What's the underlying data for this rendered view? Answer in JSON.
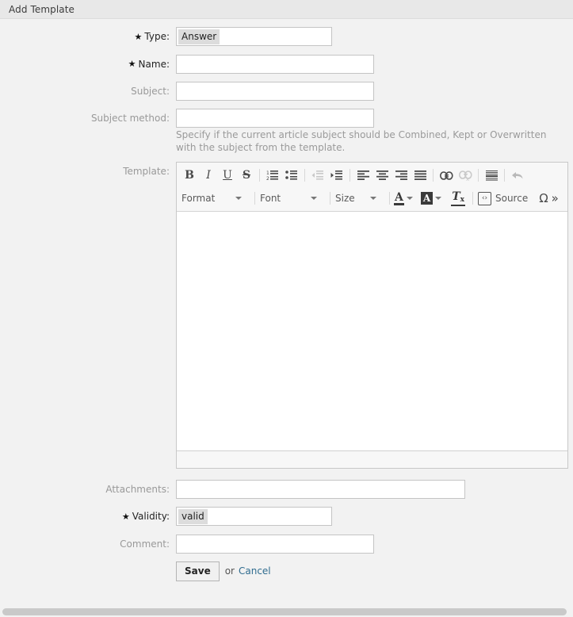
{
  "window": {
    "title": "Add Template"
  },
  "form": {
    "fields": [
      {
        "key": "type",
        "label": "Type:",
        "required": true,
        "control": "listbox",
        "value": "Answer"
      },
      {
        "key": "name",
        "label": "Name:",
        "required": true,
        "control": "text",
        "value": "",
        "placeholder": ""
      },
      {
        "key": "subject",
        "label": "Subject:",
        "required": false,
        "control": "text",
        "value": "",
        "placeholder": ""
      },
      {
        "key": "subject_method",
        "label": "Subject method:",
        "required": false,
        "control": "text",
        "value": "",
        "placeholder": "",
        "hint": "Specify if the current article subject should be Combined, Kept or Overwritten with the subject from the template."
      },
      {
        "key": "template",
        "label": "Template:",
        "required": false,
        "control": "richtext",
        "value": ""
      },
      {
        "key": "attachments",
        "label": "Attachments:",
        "required": false,
        "control": "text",
        "value": "",
        "placeholder": ""
      },
      {
        "key": "validity",
        "label": "Validity:",
        "required": true,
        "control": "listbox",
        "value": "valid"
      },
      {
        "key": "comment",
        "label": "Comment:",
        "required": false,
        "control": "text",
        "value": "",
        "placeholder": ""
      }
    ],
    "required_marker": "★"
  },
  "editor": {
    "toolbar_row1": [
      {
        "name": "bold",
        "glyph": "B",
        "disabled": false
      },
      {
        "name": "italic",
        "glyph": "I",
        "disabled": false
      },
      {
        "name": "underline",
        "glyph": "U",
        "disabled": false
      },
      {
        "name": "strikethrough",
        "glyph": "S",
        "disabled": false
      },
      {
        "name": "separator"
      },
      {
        "name": "numbered-list",
        "disabled": false
      },
      {
        "name": "bulleted-list",
        "disabled": false
      },
      {
        "name": "separator"
      },
      {
        "name": "decrease-indent",
        "disabled": true
      },
      {
        "name": "increase-indent",
        "disabled": false
      },
      {
        "name": "separator"
      },
      {
        "name": "align-left",
        "disabled": false
      },
      {
        "name": "align-center",
        "disabled": false
      },
      {
        "name": "align-right",
        "disabled": false
      },
      {
        "name": "align-justify",
        "disabled": false
      },
      {
        "name": "separator"
      },
      {
        "name": "link",
        "disabled": false
      },
      {
        "name": "unlink",
        "disabled": true
      },
      {
        "name": "separator"
      },
      {
        "name": "horizontal-rule",
        "disabled": false
      },
      {
        "name": "separator"
      },
      {
        "name": "undo",
        "disabled": false
      }
    ],
    "format_label": "Format",
    "font_label": "Font",
    "size_label": "Size",
    "text_color_glyph": "A",
    "bg_color_glyph": "A",
    "remove_format_glyph": "T",
    "remove_format_sub": "x",
    "source_label": "Source",
    "source_icon_glyph": "‹›",
    "special_char_glyph": "Ω",
    "clipped_glyph": "»",
    "content": ""
  },
  "actions": {
    "save_label": "Save",
    "or_label": "or",
    "cancel_label": "Cancel"
  }
}
